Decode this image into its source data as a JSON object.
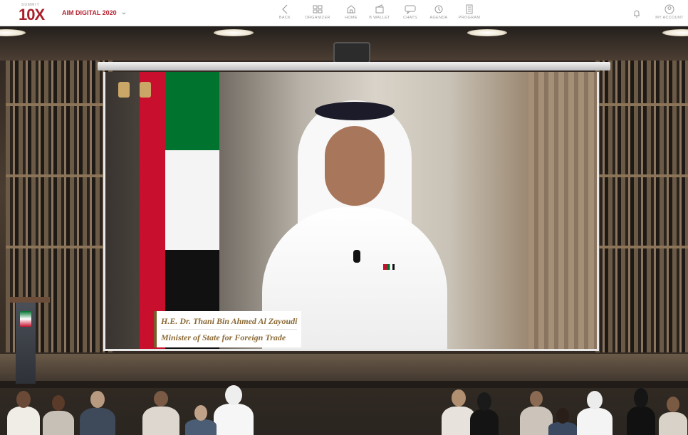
{
  "header": {
    "logo_small": "SUMMIT",
    "logo_big": "10X",
    "event_name": "AIM DIGITAL 2020",
    "nav": [
      {
        "label": "BACK",
        "icon": "chevron-left-icon"
      },
      {
        "label": "ORGANIZER",
        "icon": "grid-icon"
      },
      {
        "label": "HOME",
        "icon": "home-icon"
      },
      {
        "label": "B WALLET",
        "icon": "wallet-icon"
      },
      {
        "label": "CHATS",
        "icon": "chat-icon"
      },
      {
        "label": "AGENDA",
        "icon": "agenda-icon"
      },
      {
        "label": "PROGRAM",
        "icon": "program-icon"
      }
    ],
    "notifications_icon": "bell-icon",
    "account_label": "MY ACCOUNT",
    "account_icon": "account-icon"
  },
  "video": {
    "speaker_name": "H.E. Dr. Thani Bin Ahmed Al Zayoudi",
    "speaker_title": "Minister of State for Foreign Trade"
  },
  "colors": {
    "brand_red": "#b52230",
    "caption_text": "#8b6a36"
  }
}
